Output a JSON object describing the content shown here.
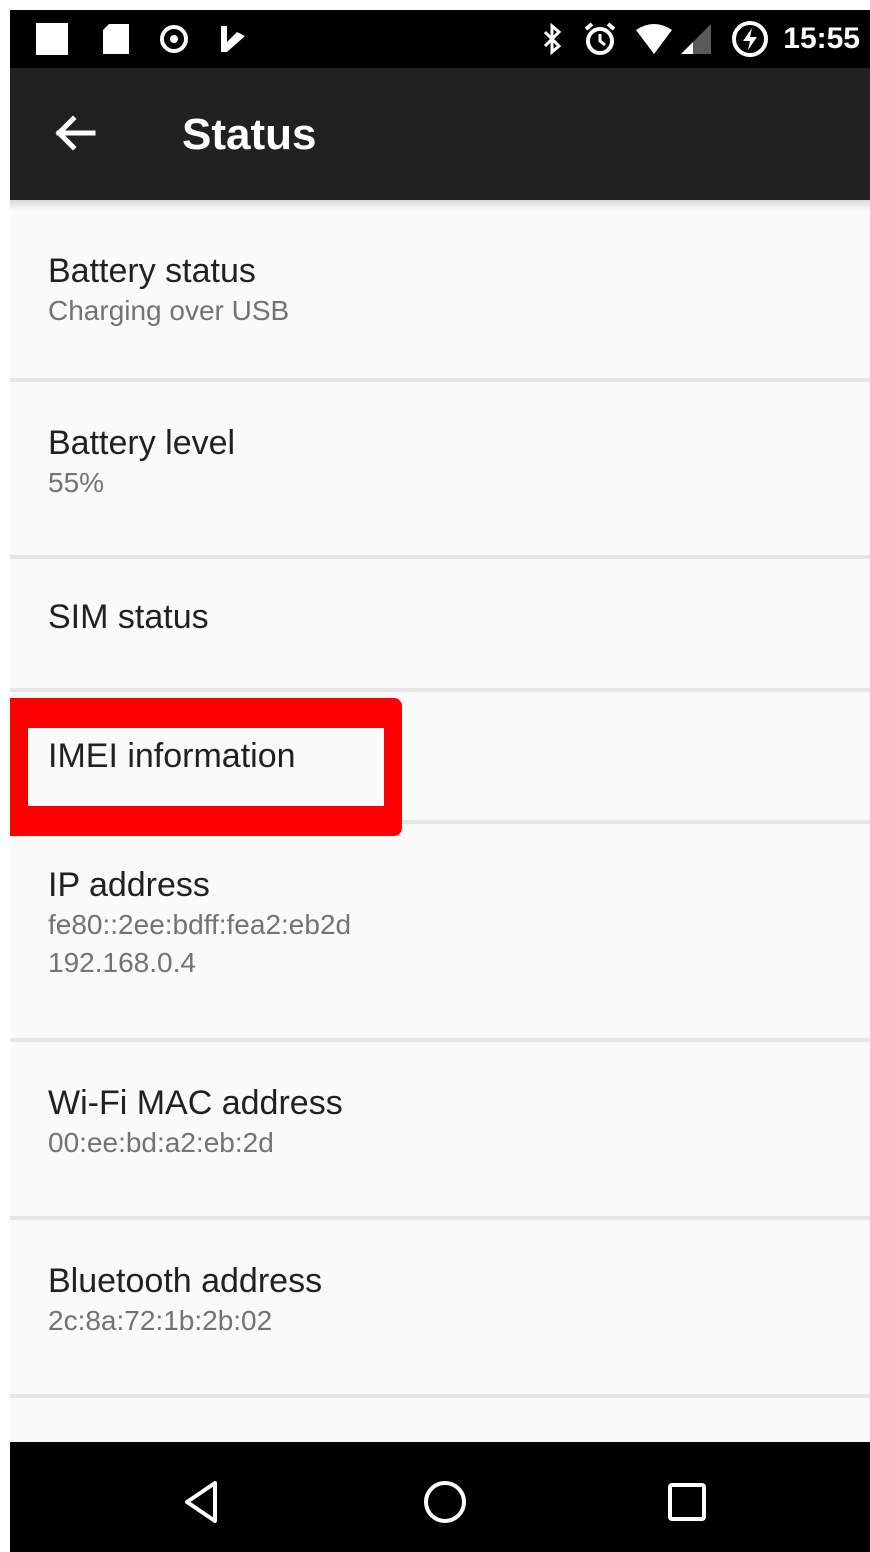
{
  "status_bar": {
    "time": "15:55",
    "left_icons": [
      "blank-notification-icon",
      "sd-card-icon",
      "alarm-record-icon",
      "tasker-icon"
    ],
    "right_icons": [
      "bluetooth-icon",
      "alarm-clock-icon",
      "wifi-icon",
      "cell-signal-icon",
      "battery-charging-icon"
    ]
  },
  "app_bar": {
    "title": "Status",
    "back_icon": "arrow-back-icon"
  },
  "items": [
    {
      "title": "Battery status",
      "subtitle": "Charging over USB"
    },
    {
      "title": "Battery level",
      "subtitle": "55%"
    },
    {
      "title": "SIM status",
      "subtitle": ""
    },
    {
      "title": "IMEI information",
      "subtitle": ""
    },
    {
      "title": "IP address",
      "subtitle": "fe80::2ee:bdff:fea2:eb2d",
      "subtitle2": "192.168.0.4"
    },
    {
      "title": "Wi-Fi MAC address",
      "subtitle": "00:ee:bd:a2:eb:2d"
    },
    {
      "title": "Bluetooth address",
      "subtitle": "2c:8a:72:1b:2b:02"
    }
  ],
  "highlight": {
    "target": "IMEI information",
    "color": "#ff0000"
  },
  "nav_bar": {
    "icons": [
      "back-triangle-icon",
      "home-circle-icon",
      "recents-square-icon"
    ]
  },
  "colors": {
    "app_bar": "#212121",
    "status_bar": "#000000",
    "background": "#fafafa"
  }
}
